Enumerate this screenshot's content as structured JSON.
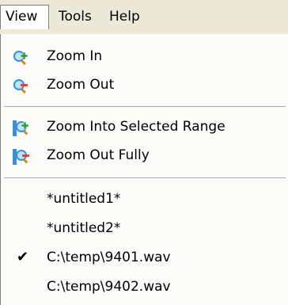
{
  "menubar": {
    "items": [
      {
        "label": "View"
      },
      {
        "label": "Tools"
      },
      {
        "label": "Help"
      }
    ]
  },
  "view_menu": {
    "zoom_in": {
      "label": "Zoom In",
      "icon": "zoom-in-icon"
    },
    "zoom_out": {
      "label": "Zoom Out",
      "icon": "zoom-out-icon"
    },
    "zoom_selected": {
      "label": "Zoom Into Selected Range",
      "icon": "zoom-selected-icon"
    },
    "zoom_out_fully": {
      "label": "Zoom Out Fully",
      "icon": "zoom-out-fully-icon"
    },
    "files": [
      {
        "label": "*untitled1*",
        "checked": false
      },
      {
        "label": "*untitled2*",
        "checked": false
      },
      {
        "label": "C:\\temp\\9401.wav",
        "checked": true
      },
      {
        "label": "C:\\temp\\9402.wav",
        "checked": false
      }
    ],
    "check_glyph": "✔"
  },
  "colors": {
    "menu_bg": "#ece9d8",
    "dropdown_bg": "#fbfbf9",
    "icon_blue": "#3b8fd8",
    "icon_green": "#2f9a3a",
    "icon_red": "#e0443c"
  }
}
